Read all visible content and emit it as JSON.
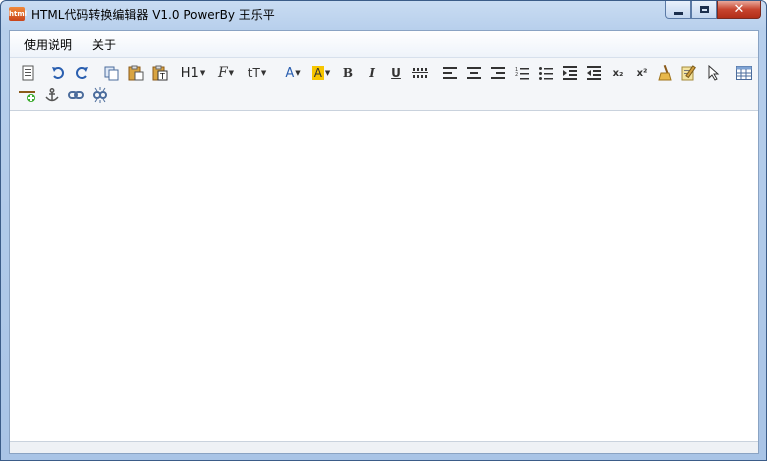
{
  "window": {
    "title": "HTML代码转换编辑器 V1.0  PowerBy 王乐平",
    "icon_text": "html"
  },
  "menu": {
    "items": [
      "使用说明",
      "关于"
    ]
  },
  "toolbar": {
    "heading": "H1",
    "font": "F",
    "size": "tT",
    "text_color": "A",
    "highlight": "A",
    "bold": "B",
    "italic": "I",
    "underline": "U",
    "subscript": "x₂",
    "superscript": "x²"
  },
  "editor": {
    "content": ""
  }
}
